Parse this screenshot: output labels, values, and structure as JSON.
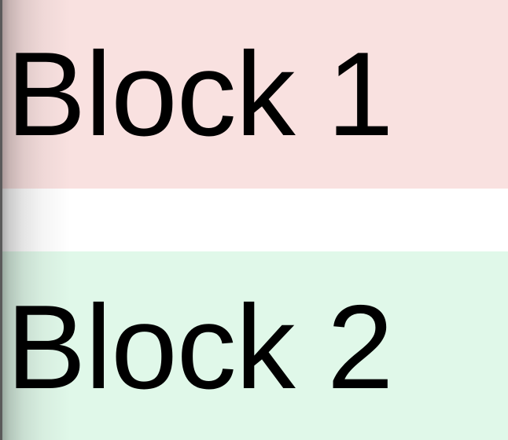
{
  "blocks": [
    {
      "label": "Block 1",
      "background": "#f9e1e0"
    },
    {
      "label": "Block 2",
      "background": "#e0f8e9"
    }
  ]
}
